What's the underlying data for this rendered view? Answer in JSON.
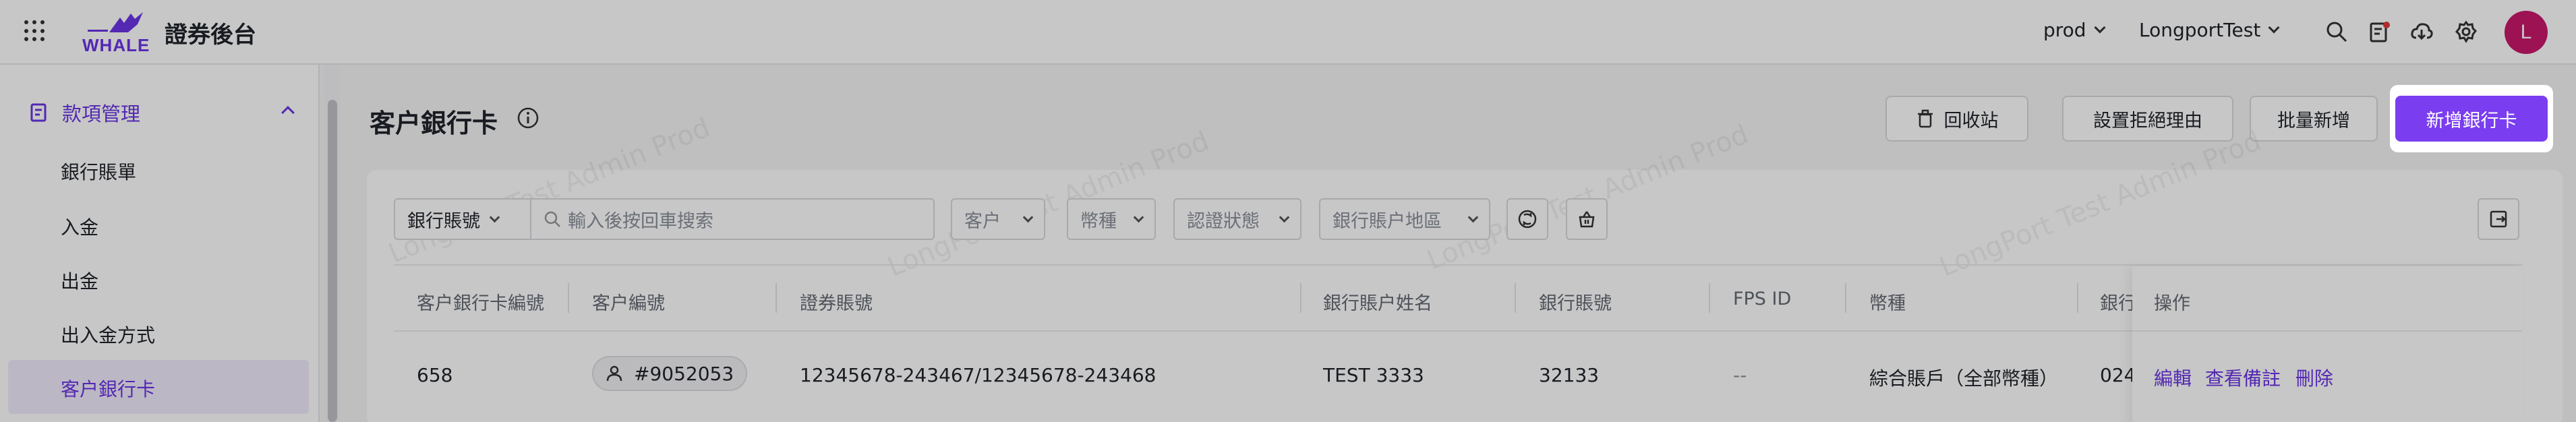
{
  "header": {
    "logo_text": "WHALE",
    "app_title": "證券後台",
    "env": "prod",
    "org": "LongportTest",
    "avatar_letter": "L",
    "icons": [
      "grid-icon",
      "search-icon",
      "task-icon",
      "cloud-download-icon",
      "settings-icon"
    ]
  },
  "sidebar": {
    "group_label": "款項管理",
    "items": [
      {
        "label": "銀行賬單"
      },
      {
        "label": "入金"
      },
      {
        "label": "出金"
      },
      {
        "label": "出入金方式"
      },
      {
        "label": "客户銀行卡",
        "active": true
      }
    ]
  },
  "page": {
    "title": "客户銀行卡",
    "buttons": {
      "recycle": "回收站",
      "reject_reason": "設置拒絕理由",
      "batch_add": "批量新增",
      "add_card": "新增銀行卡"
    }
  },
  "filters": {
    "field_select": "銀行賬號",
    "search_placeholder": "輸入後按回車搜索",
    "customer": "客户",
    "currency": "幣種",
    "auth_status": "認證狀態",
    "region": "銀行賬户地區"
  },
  "table": {
    "headers": [
      "客户銀行卡編號",
      "客户編號",
      "證券賬號",
      "銀行賬户姓名",
      "銀行賬號",
      "FPS ID",
      "幣種",
      "銀行",
      "操作"
    ],
    "rows": [
      {
        "card_no": "658",
        "customer_no": "#9052053",
        "securities_account": "12345678-243467/12345678-243468",
        "account_name": "TEST 3333",
        "bank_account": "32133",
        "fps_id": "--",
        "currency": "綜合賬戶（全部幣種）",
        "bank_partial": "024",
        "actions": [
          "編輯",
          "查看備註",
          "刪除"
        ]
      }
    ]
  },
  "watermark": "LongPort Test Admin Prod",
  "colors": {
    "accent": "#7a3df0",
    "avatar": "#c8186b"
  }
}
